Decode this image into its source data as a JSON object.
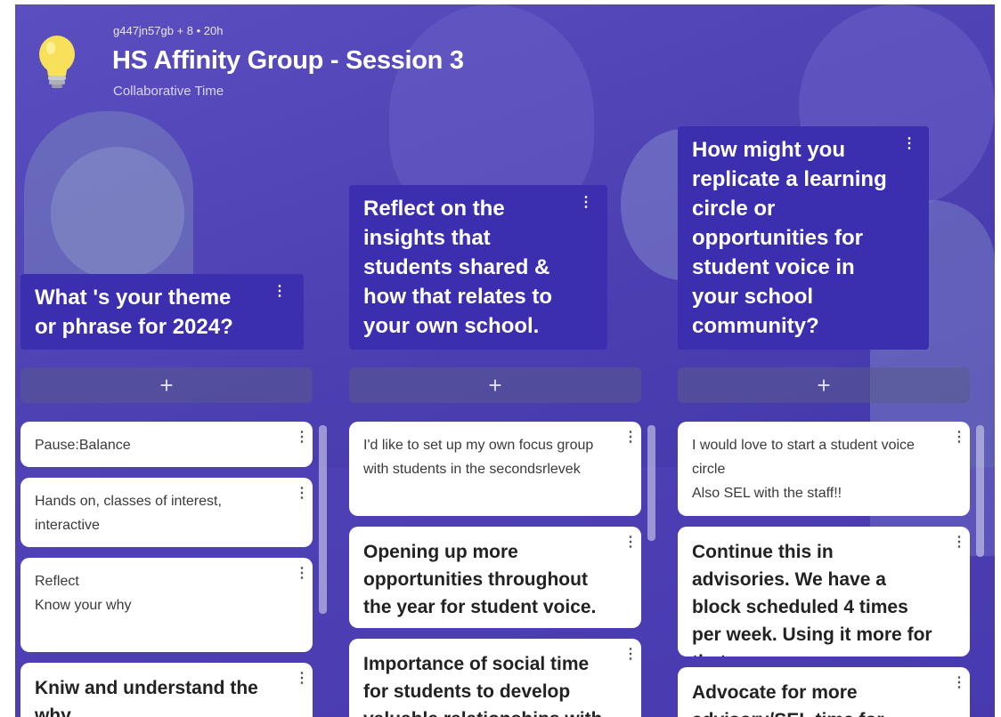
{
  "header": {
    "meta": "g447jn57gb + 8 • 20h",
    "title": "HS Affinity Group - Session 3",
    "subtitle": "Collaborative Time"
  },
  "columns": [
    {
      "title": "What 's your theme or phrase for 2024?",
      "add_label": "+",
      "cards": [
        {
          "text": "Pause:Balance"
        },
        {
          "text": "Hands on, classes of interest, interactive"
        },
        {
          "text": "Reflect\nKnow your why"
        },
        {
          "text": "Kniw and understand the why."
        }
      ]
    },
    {
      "title": "Reflect on the insights that students shared & how that relates to your own school.",
      "add_label": "+",
      "cards": [
        {
          "text": "I'd like to set up my own focus group with students in the secondsrlevek"
        },
        {
          "text": "Opening up more opportunities throughout the year for student voice."
        },
        {
          "text": "Importance of social time for students to develop valuable relationships with"
        }
      ]
    },
    {
      "title": "How might you replicate a learning circle or opportunities for student voice in your school community?",
      "add_label": "+",
      "cards": [
        {
          "text": "I would love to start a student voice circle\nAlso SEL with the staff!!"
        },
        {
          "text": "Continue this in advisories. We have a block scheduled 4 times per week.  Using it  more for that"
        },
        {
          "text": "Advocate for more advisory/SEL time for"
        }
      ]
    }
  ],
  "icons": {
    "header_icon": "lightbulb-icon",
    "menu_icon": "kebab-menu-icon",
    "add_icon": "plus-icon"
  }
}
